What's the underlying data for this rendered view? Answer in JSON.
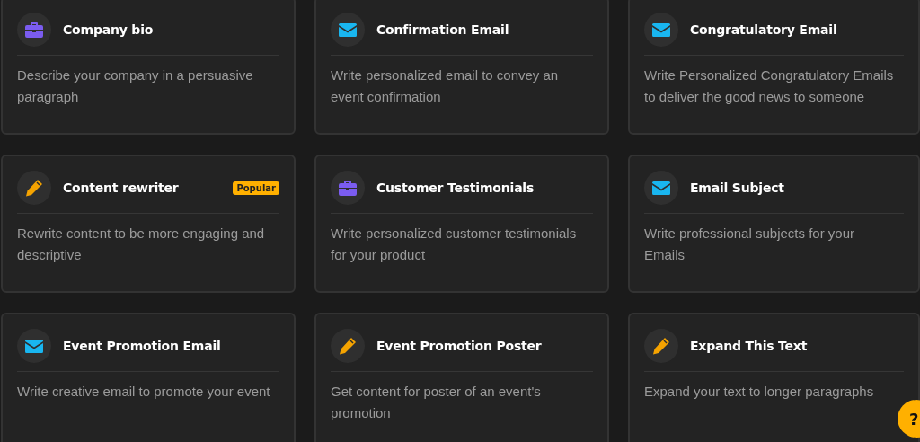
{
  "templates": [
    {
      "kind": "briefcase",
      "title": "Company bio",
      "description": "Describe your company in a persuasive paragraph"
    },
    {
      "kind": "envelope",
      "title": "Confirmation Email",
      "description": "Write personalized email to convey an event confirmation"
    },
    {
      "kind": "envelope",
      "title": "Congratulatory Email",
      "description": "Write Personalized Congratulatory Emails to deliver the good news to someone"
    },
    {
      "kind": "pencil",
      "title": "Content rewriter",
      "badge": "Popular",
      "description": "Rewrite content to be more engaging and descriptive"
    },
    {
      "kind": "briefcase",
      "title": "Customer Testimonials",
      "description": "Write personalized customer testimonials for your product"
    },
    {
      "kind": "envelope",
      "title": "Email Subject",
      "description": "Write professional subjects for your Emails"
    },
    {
      "kind": "envelope",
      "title": "Event Promotion Email",
      "description": "Write creative email to promote your event"
    },
    {
      "kind": "pencil",
      "title": "Event Promotion Poster",
      "description": "Get content for poster of an event's promotion"
    },
    {
      "kind": "pencil",
      "title": "Expand This Text",
      "description": "Expand your text to longer paragraphs"
    }
  ],
  "help_button": {
    "label": "?"
  }
}
